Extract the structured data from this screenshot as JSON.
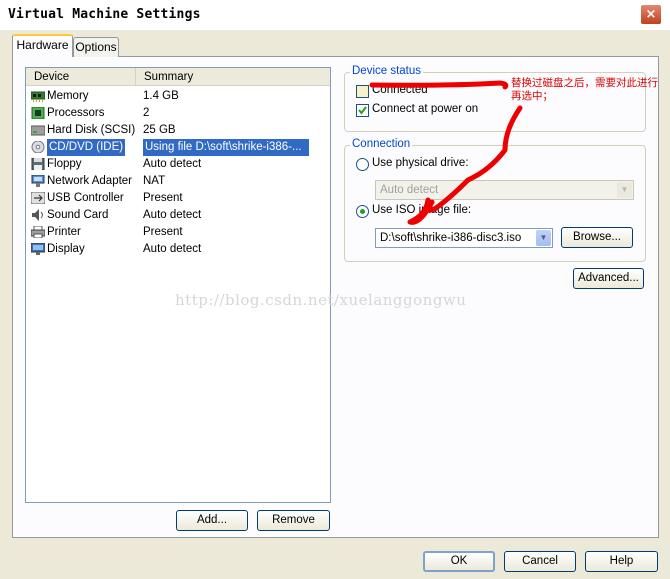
{
  "window": {
    "title": "Virtual Machine Settings",
    "close": "×"
  },
  "tabs": {
    "hardware": "Hardware",
    "options": "Options"
  },
  "device_list": {
    "headers": {
      "device": "Device",
      "summary": "Summary"
    },
    "rows": [
      {
        "icon": "memory-icon",
        "device": "Memory",
        "summary": "1.4 GB"
      },
      {
        "icon": "processor-icon",
        "device": "Processors",
        "summary": "2"
      },
      {
        "icon": "hard-disk-icon",
        "device": "Hard Disk (SCSI)",
        "summary": "25 GB"
      },
      {
        "icon": "cd-dvd-icon",
        "device": "CD/DVD (IDE)",
        "summary": "Using file D:\\soft\\shrike-i386-..."
      },
      {
        "icon": "floppy-icon",
        "device": "Floppy",
        "summary": "Auto detect"
      },
      {
        "icon": "network-adapter-icon",
        "device": "Network Adapter",
        "summary": "NAT"
      },
      {
        "icon": "usb-controller-icon",
        "device": "USB Controller",
        "summary": "Present"
      },
      {
        "icon": "sound-card-icon",
        "device": "Sound Card",
        "summary": "Auto detect"
      },
      {
        "icon": "printer-icon",
        "device": "Printer",
        "summary": "Present"
      },
      {
        "icon": "display-icon",
        "device": "Display",
        "summary": "Auto detect"
      }
    ],
    "selected_index": 3
  },
  "buttons": {
    "add": "Add...",
    "remove": "Remove",
    "ok": "OK",
    "cancel": "Cancel",
    "help": "Help",
    "browse": "Browse...",
    "advanced": "Advanced..."
  },
  "device_status": {
    "legend": "Device status",
    "connected": {
      "label": "Connected",
      "checked": false
    },
    "connect_at_power_on": {
      "label": "Connect at power on",
      "checked": true
    }
  },
  "connection": {
    "legend": "Connection",
    "use_physical_drive": {
      "label": "Use physical drive:",
      "selected": false
    },
    "physical_drive_value": "Auto detect",
    "use_iso_image": {
      "label": "Use ISO image file:",
      "selected": true
    },
    "iso_path": "D:\\soft\\shrike-i386-disc3.iso"
  },
  "annotation": "替换过磁盘之后，需要对此进行再选中；",
  "watermark": "http://blog.csdn.net/xuelanggongwu",
  "colors": {
    "selection": "#316ac5",
    "annotation": "#dd0000",
    "legend": "#0046d5"
  }
}
